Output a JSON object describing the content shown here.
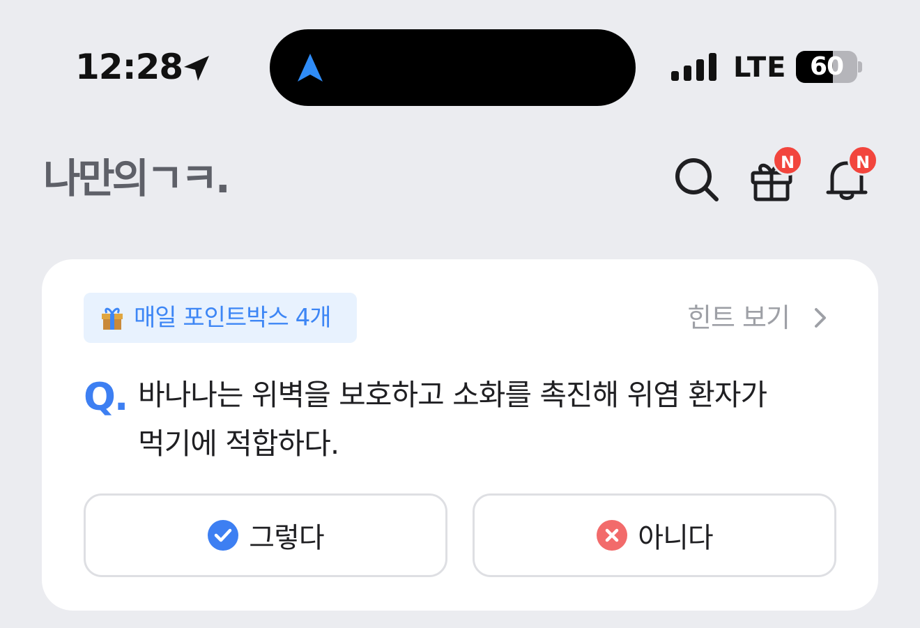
{
  "status_bar": {
    "time": "12:28",
    "network": "LTE",
    "battery": "60",
    "battery_level": 0.6
  },
  "header": {
    "logo": "나만의ㄱㅋ.",
    "search_icon": "search-icon",
    "gift_badge": "N",
    "bell_badge": "N"
  },
  "quiz": {
    "pill_label": "매일 포인트박스 4개",
    "hint_label": "힌트 보기",
    "q_mark": "Q.",
    "question": "바나나는 위벽을 보호하고 소화를 촉진해 위염 환자가 먹기에 적합하다.",
    "yes_label": "그렇다",
    "no_label": "아니다"
  },
  "colors": {
    "accent": "#3d86f5",
    "badge": "#f2453d",
    "no_icon": "#f26b6b",
    "background": "#ebecf0"
  }
}
